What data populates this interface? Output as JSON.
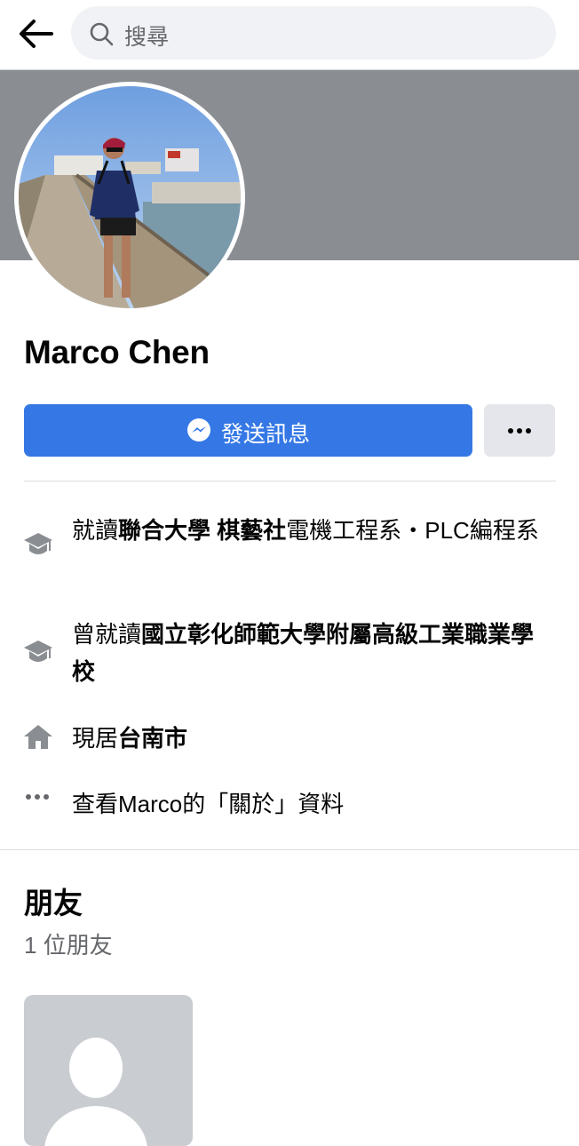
{
  "topbar": {
    "search_placeholder": "搜尋"
  },
  "profile": {
    "name": "Marco Chen",
    "message_button_label": "發送訊息"
  },
  "intro": {
    "education1": {
      "prefix": "就讀",
      "bold": "聯合大學 棋藝社",
      "suffix": "電機工程系・PLC編程系"
    },
    "education2": {
      "prefix": "曾就讀",
      "bold": "國立彰化師範大學附屬高級工業職業學校"
    },
    "location": {
      "prefix": "現居",
      "bold": "台南市"
    },
    "about_link": "查看Marco的「關於」資料"
  },
  "friends": {
    "title": "朋友",
    "count": "1 位朋友"
  },
  "colors": {
    "accent": "#3578e5",
    "cover": "#8a8d91",
    "muted_text": "#65676b"
  },
  "icons": [
    "back-arrow-icon",
    "search-icon",
    "messenger-icon",
    "more-dots-icon",
    "graduation-cap-icon",
    "home-icon"
  ]
}
